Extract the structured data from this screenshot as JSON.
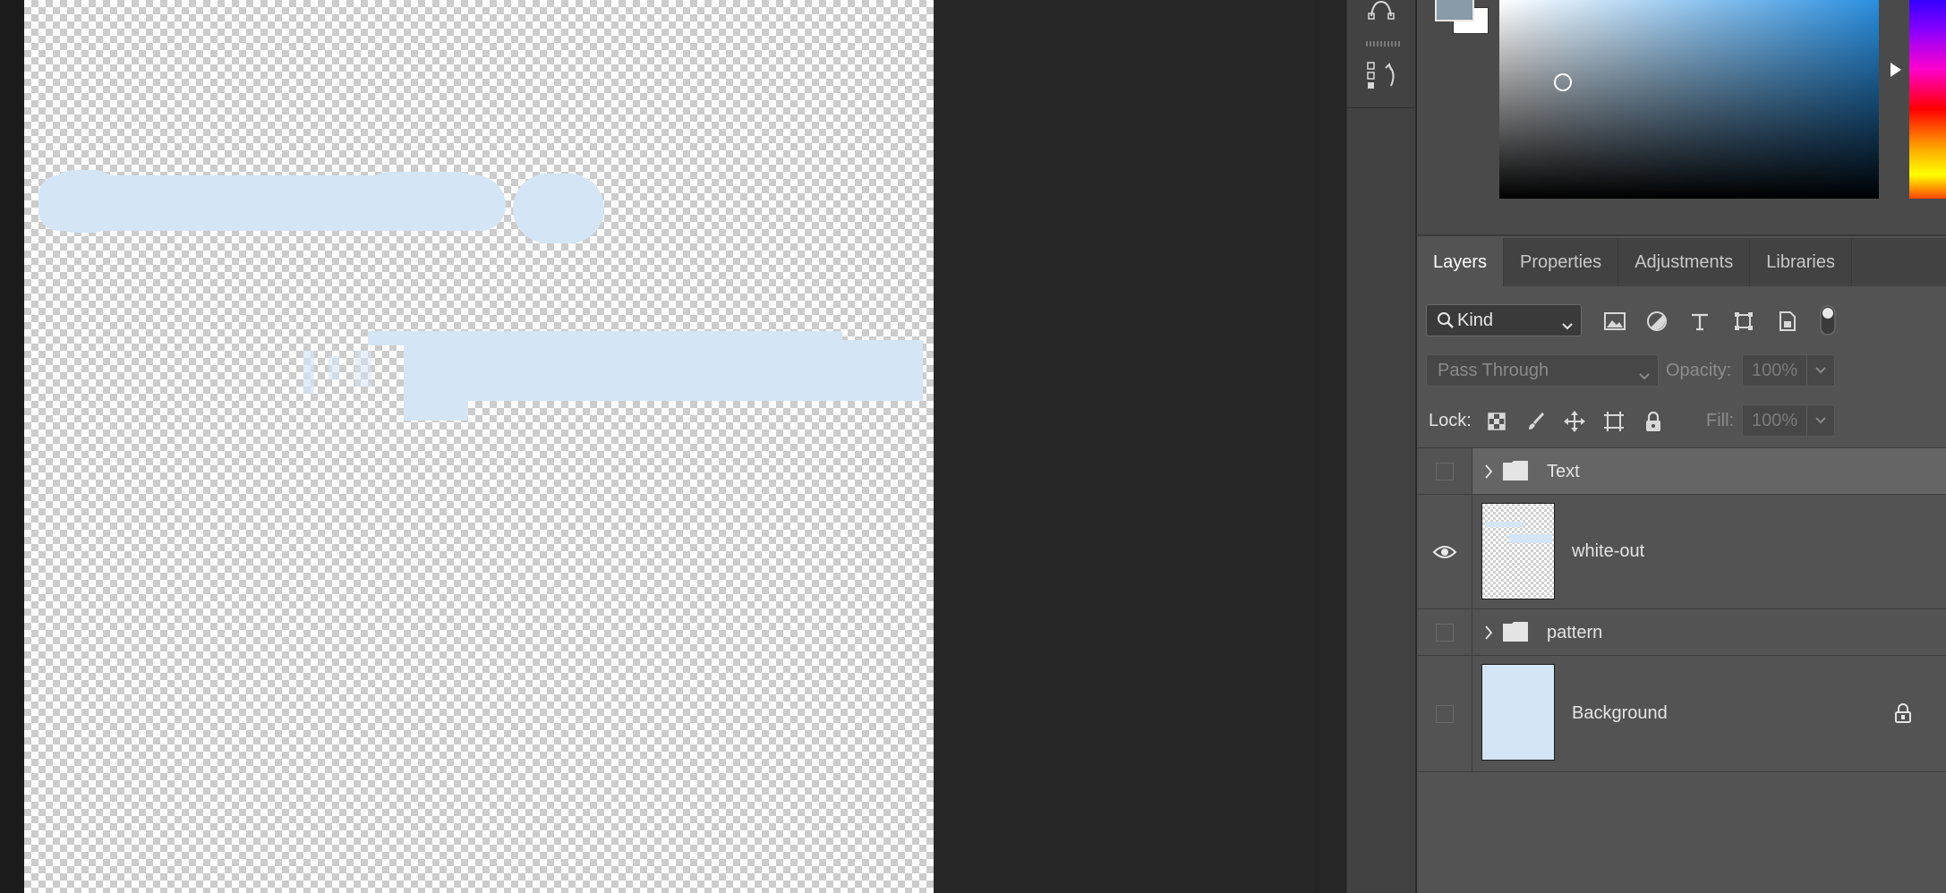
{
  "panel": {
    "tabs": [
      "Layers",
      "Properties",
      "Adjustments",
      "Libraries"
    ],
    "active_tab": "Layers"
  },
  "filter": {
    "kind_label": "Kind",
    "icons": [
      "image-filter-icon",
      "adjustment-filter-icon",
      "type-filter-icon",
      "shape-filter-icon",
      "smart-object-filter-icon",
      "filter-toggle-icon"
    ]
  },
  "blend": {
    "mode": "Pass Through",
    "opacity_label": "Opacity:",
    "opacity_value": "100%",
    "lock_label": "Lock:",
    "fill_label": "Fill:",
    "fill_value": "100%"
  },
  "layers": [
    {
      "name": "Text",
      "type": "group",
      "visible": false,
      "selected": true
    },
    {
      "name": "white-out",
      "type": "layer",
      "visible": true,
      "selected": false
    },
    {
      "name": "pattern",
      "type": "group",
      "visible": false,
      "selected": false
    },
    {
      "name": "Background",
      "type": "layer",
      "visible": false,
      "selected": false,
      "locked": true
    }
  ],
  "colors": {
    "foreground": "#8a9aa6",
    "background": "#ffffff",
    "whiteout_fill": "#d4e6f6"
  }
}
